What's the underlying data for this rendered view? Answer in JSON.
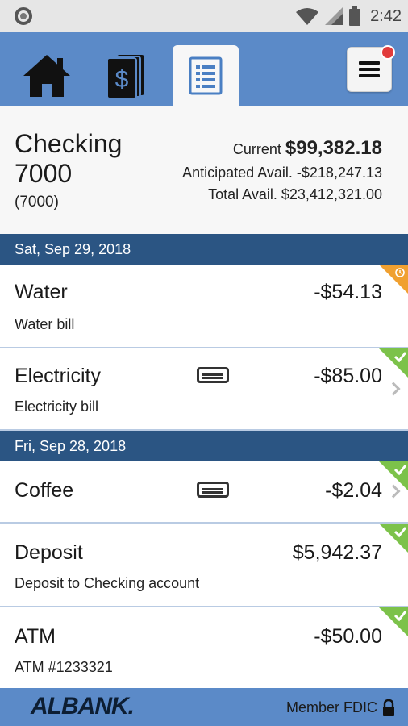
{
  "status_bar": {
    "time": "2:42"
  },
  "nav": {
    "tabs": [
      {
        "name": "home",
        "icon": "home-icon",
        "active": false
      },
      {
        "name": "accounts",
        "icon": "dollar-cards-icon",
        "active": false
      },
      {
        "name": "activity",
        "icon": "document-list-icon",
        "active": true
      }
    ],
    "menu_icon": "hamburger-menu-icon",
    "notification_color": "#e23b3b"
  },
  "account": {
    "name": "Checking 7000",
    "number": "(7000)",
    "current_label": "Current",
    "current_amount": "$99,382.18",
    "anticipated_label": "Anticipated Avail.",
    "anticipated_amount": "-$218,247.13",
    "total_label": "Total Avail.",
    "total_amount": "$23,412,321.00"
  },
  "groups": [
    {
      "date": "Sat, Sep 29, 2018",
      "transactions": [
        {
          "title": "Water",
          "description": "Water bill",
          "amount": "-$54.13",
          "status": "pending",
          "status_color": "#f0a030",
          "has_card": false,
          "has_chevron": false
        },
        {
          "title": "Electricity",
          "description": "Electricity bill",
          "amount": "-$85.00",
          "status": "cleared",
          "status_color": "#7cc24a",
          "has_card": true,
          "has_chevron": true
        }
      ]
    },
    {
      "date": "Fri, Sep 28, 2018",
      "transactions": [
        {
          "title": "Coffee",
          "description": "",
          "amount": "-$2.04",
          "status": "cleared",
          "status_color": "#7cc24a",
          "has_card": true,
          "has_chevron": true
        },
        {
          "title": "Deposit",
          "description": "Deposit to Checking account",
          "amount": "$5,942.37",
          "status": "cleared",
          "status_color": "#7cc24a",
          "has_card": false,
          "has_chevron": false
        },
        {
          "title": "ATM",
          "description": "ATM #1233321",
          "amount": "-$50.00",
          "status": "cleared",
          "status_color": "#7cc24a",
          "has_card": false,
          "has_chevron": false
        }
      ]
    }
  ],
  "footer": {
    "logo": "ALBANK.",
    "fdic": "Member FDIC",
    "lock_icon": "lock-icon"
  },
  "colors": {
    "nav_blue": "#5b8ac8",
    "date_bar": "#2b5583",
    "pending": "#f0a030",
    "cleared": "#7cc24a"
  }
}
